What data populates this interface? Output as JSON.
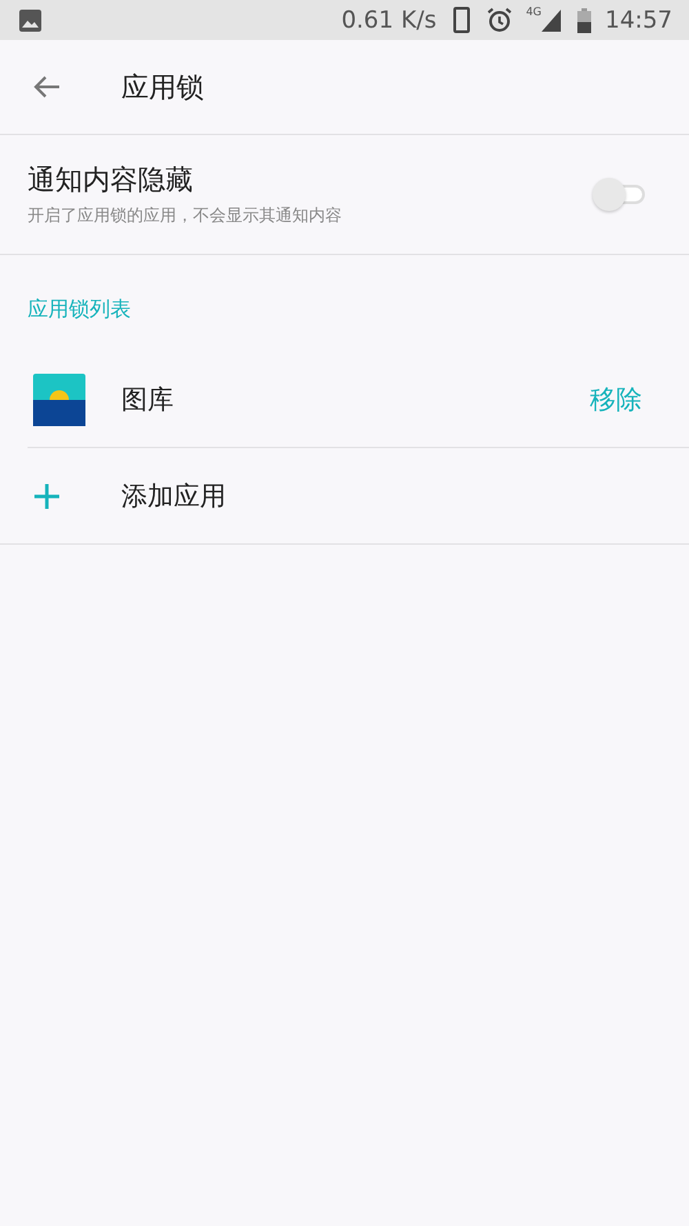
{
  "status_bar": {
    "speed": "0.61 K/s",
    "network": "4G",
    "time": "14:57"
  },
  "header": {
    "title": "应用锁"
  },
  "setting": {
    "title": "通知内容隐藏",
    "subtitle": "开启了应用锁的应用，不会显示其通知内容",
    "on": false
  },
  "section": {
    "title": "应用锁列表"
  },
  "apps": [
    {
      "name": "图库",
      "action": "移除"
    }
  ],
  "add": {
    "label": "添加应用"
  }
}
